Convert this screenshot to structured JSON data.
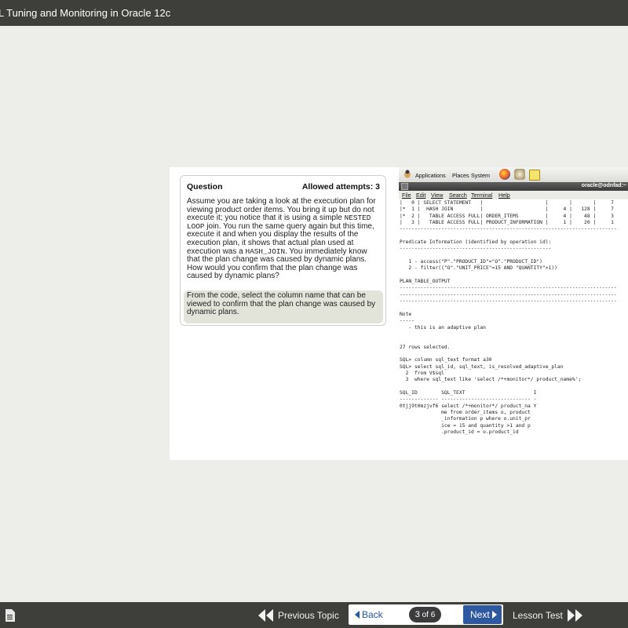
{
  "header": {
    "title": "L Tuning and Monitoring in Oracle 12c"
  },
  "question": {
    "heading": "Question",
    "attempts": "Allowed attempts: 3",
    "body": [
      {
        "t": "Assume you are taking a look at the execution plan for viewing product order items. You bring it up but do not execute it; you notice that it is using a simple "
      },
      {
        "t": "NESTED LOOP",
        "mono": true
      },
      {
        "t": " join. You run the same query again but this time, execute it and when you display the results of the execution plan, it shows that actual plan used at execution was a "
      },
      {
        "t": "HASH_JOIN",
        "mono": true
      },
      {
        "t": ". You immediately know that the plan change was caused by dynamic plans. How would you confirm that the plan change was caused by dynamic plans?"
      }
    ],
    "instruction": "From the code, select the column name that can be viewed to confirm that the plan change was caused by dynamic plans."
  },
  "desktop": {
    "menus": {
      "applications": "Applications",
      "places": "Places",
      "system": "System"
    },
    "icons": [
      "firefox-icon",
      "settings-icon",
      "notes-icon"
    ],
    "window_title": "oracle@odnfad:~",
    "terminal_menu": [
      "File",
      "Edit",
      "View",
      "Search",
      "Terminal",
      "Help"
    ],
    "terminal_lines": [
      "|   0 | SELECT STATEMENT   |                     |       |       |     7",
      "|*  1 |  HASH JOIN         |                     |     4 |   128 |     7",
      "|*  2 |   TABLE ACCESS FULL| ORDER_ITEMS         |     4 |    48 |     3",
      "|   3 |   TABLE ACCESS FULL| PRODUCT_INFORMATION |     1 |    20 |     1",
      "-------------------------------------------------------------------------",
      "",
      "Predicate Information (identified by operation id):",
      "---------------------------------------------------",
      "",
      "   1 - access(\"P\".\"PRODUCT_ID\"=\"O\".\"PRODUCT_ID\")",
      "   2 - filter((\"O\".\"UNIT_PRICE\"=15 AND \"QUANTITY\">1))",
      "",
      "PLAN_TABLE_OUTPUT",
      "-------------------------------------------------------------------------",
      "-------------------------------------------------------------------------",
      "-------------------------------------------------------------------------",
      "",
      "Note",
      "-----",
      "   - this is an adaptive plan",
      "",
      "",
      "27 rows selected.",
      "",
      "SQL> column sql_text format a30",
      "SQL> select sql_id, sql_text, is_resolved_adaptive_plan",
      "  2  from V$sql",
      "  3  where sql_text like 'select /*+monitor*/ product_name%';",
      "",
      "SQL_ID        SQL_TEXT                       I",
      "------------- ------------------------------ -",
      "0tjj9t0mzjvf6 select /*+monitor*/ product_na Y",
      "              me from order_items o, product",
      "              _information p where o.unit_pr",
      "              ice = 15 and quantity >1 and p",
      "              .product_id = o.product_id"
    ]
  },
  "footer": {
    "previous_topic": "Previous Topic",
    "back": "Back",
    "page_current": "3",
    "page_of": "of 6",
    "next": "Next",
    "lesson_test": "Lesson Test"
  }
}
